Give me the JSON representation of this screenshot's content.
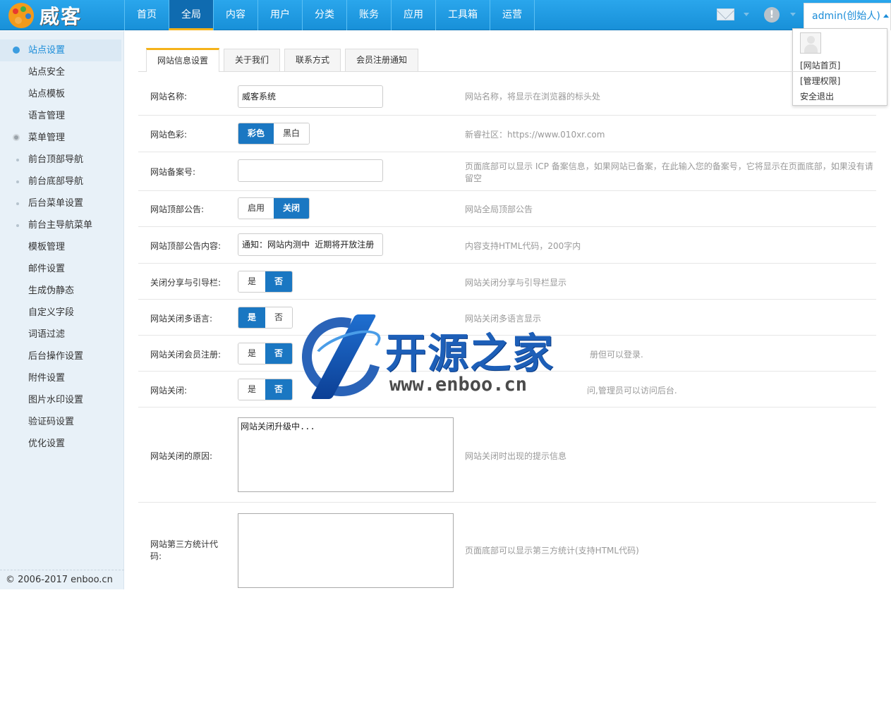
{
  "app": {
    "logo_text": "威客",
    "copyright": "© 2006-2017 enboo.cn"
  },
  "nav": {
    "items": [
      {
        "label": "首页",
        "active": false
      },
      {
        "label": "全局",
        "active": true
      },
      {
        "label": "内容",
        "active": false
      },
      {
        "label": "用户",
        "active": false
      },
      {
        "label": "分类",
        "active": false
      },
      {
        "label": "账务",
        "active": false
      },
      {
        "label": "应用",
        "active": false
      },
      {
        "label": "工具箱",
        "active": false
      },
      {
        "label": "运营",
        "active": false
      }
    ]
  },
  "header": {
    "mail_icon": "mail-icon",
    "alert_icon": "alert-icon",
    "alert_glyph": "!",
    "user_label": "admin(创始人)"
  },
  "user_menu": {
    "items": [
      "[网站首页]",
      "[管理权限]",
      "安全退出"
    ]
  },
  "sidebar": {
    "items": [
      {
        "label": "站点设置",
        "type": "group",
        "active": true
      },
      {
        "label": "站点安全",
        "type": "item"
      },
      {
        "label": "站点模板",
        "type": "item"
      },
      {
        "label": "语言管理",
        "type": "item"
      },
      {
        "label": "菜单管理",
        "type": "group-gray"
      },
      {
        "label": "前台顶部导航",
        "type": "sub"
      },
      {
        "label": "前台底部导航",
        "type": "sub"
      },
      {
        "label": "后台菜单设置",
        "type": "sub"
      },
      {
        "label": "前台主导航菜单",
        "type": "sub"
      },
      {
        "label": "模板管理",
        "type": "item"
      },
      {
        "label": "邮件设置",
        "type": "item"
      },
      {
        "label": "生成伪静态",
        "type": "item"
      },
      {
        "label": "自定义字段",
        "type": "item"
      },
      {
        "label": "词语过滤",
        "type": "item"
      },
      {
        "label": "后台操作设置",
        "type": "item"
      },
      {
        "label": "附件设置",
        "type": "item"
      },
      {
        "label": "图片水印设置",
        "type": "item"
      },
      {
        "label": "验证码设置",
        "type": "item"
      },
      {
        "label": "优化设置",
        "type": "item"
      }
    ]
  },
  "tabs": [
    {
      "label": "网站信息设置",
      "active": true
    },
    {
      "label": "关于我们",
      "active": false
    },
    {
      "label": "联系方式",
      "active": false
    },
    {
      "label": "会员注册通知",
      "active": false
    }
  ],
  "form": {
    "site_name": {
      "label": "网站名称:",
      "value": "威客系统",
      "hint": "网站名称，将显示在浏览器的标头处"
    },
    "site_color": {
      "label": "网站色彩:",
      "options": [
        "彩色",
        "黑白"
      ],
      "selected": "彩色",
      "hint": "新睿社区：https://www.010xr.com"
    },
    "icp": {
      "label": "网站备案号:",
      "value": "",
      "hint_line1": "页面底部可以显示 ICP 备案信息，如果网站已备案，在此输入您的备案号，它将显示在页面底部，如果没有请",
      "hint_line2": "留空"
    },
    "top_notice": {
      "label": "网站顶部公告:",
      "options": [
        "启用",
        "关闭"
      ],
      "selected": "关闭",
      "hint": "网站全局顶部公告"
    },
    "top_notice_content": {
      "label": "网站顶部公告内容:",
      "value": "通知：网站内测中 近期将开放注册",
      "hint": "内容支持HTML代码，200字内"
    },
    "close_share": {
      "label": "关闭分享与引导栏:",
      "options": [
        "是",
        "否"
      ],
      "selected": "否",
      "hint": "网站关闭分享与引导栏显示"
    },
    "close_multilang": {
      "label": "网站关闭多语言:",
      "options": [
        "是",
        "否"
      ],
      "selected": "是",
      "hint": "网站关闭多语言显示"
    },
    "close_register": {
      "label": "网站关闭会员注册:",
      "options": [
        "是",
        "否"
      ],
      "selected": "否",
      "hint": "册但可以登录."
    },
    "site_close": {
      "label": "网站关闭:",
      "options": [
        "是",
        "否"
      ],
      "selected": "否",
      "hint": "问,管理员可以访问后台."
    },
    "close_reason": {
      "label": "网站关闭的原因:",
      "value": "网站关闭升级中...",
      "hint": "网站关闭时出现的提示信息"
    },
    "stat_code": {
      "label": "网站第三方统计代码:",
      "value": "",
      "hint": "页面底部可以显示第三方统计(支持HTML代码)"
    }
  },
  "watermark": {
    "title": "开源之家",
    "url": "www.enboo.cn"
  },
  "colors": {
    "topbar": "#1b96dc",
    "accent": "#1a77c2",
    "active_tab_border": "#f5b21a",
    "sidebar_bg": "#e8f1f8"
  }
}
